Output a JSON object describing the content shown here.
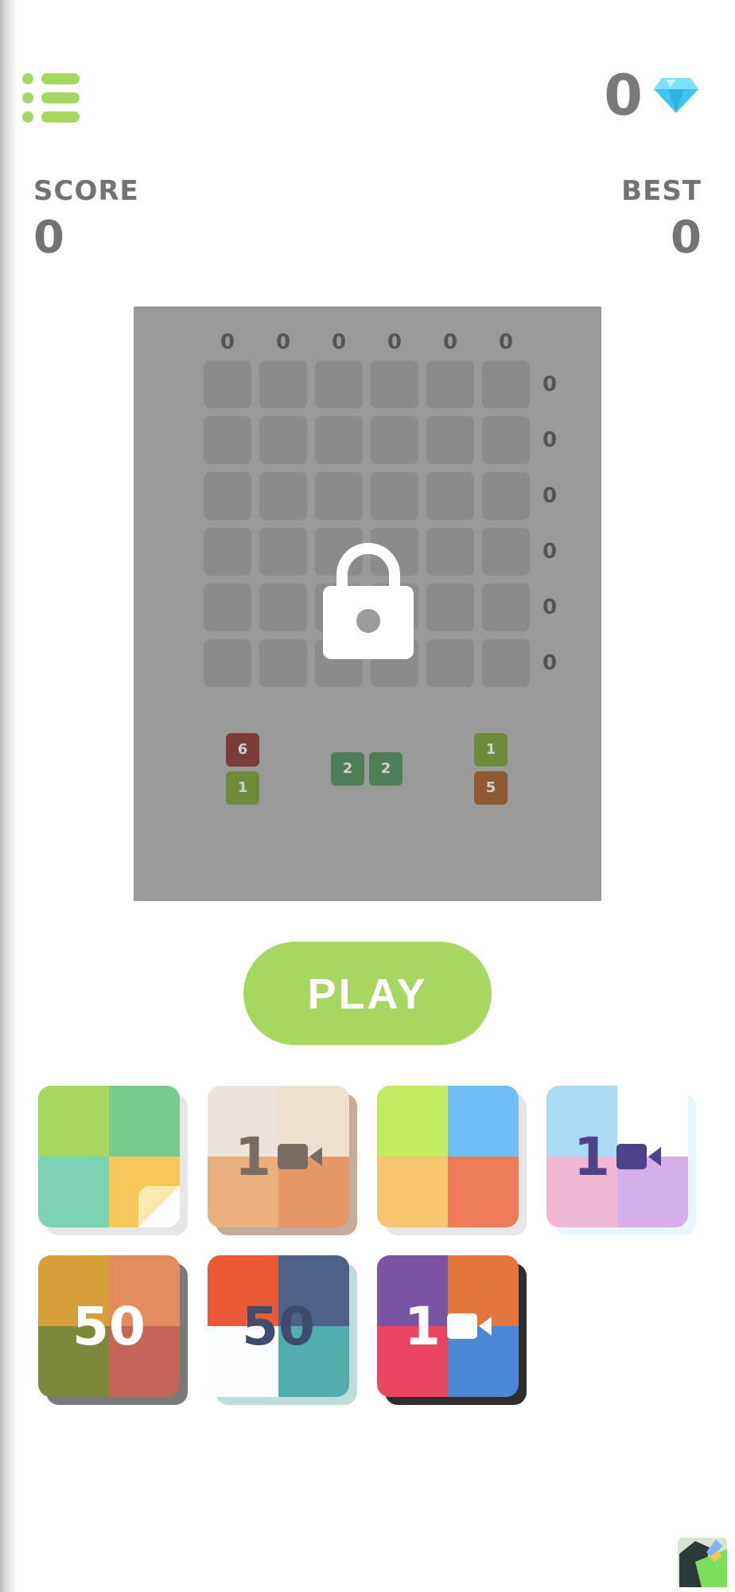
{
  "header": {
    "gems": "0"
  },
  "score": {
    "label": "SCORE",
    "value": "0"
  },
  "best": {
    "label": "BEST",
    "value": "0"
  },
  "board": {
    "col_counts": [
      "0",
      "0",
      "0",
      "0",
      "0",
      "0"
    ],
    "row_counts": [
      "0",
      "0",
      "0",
      "0",
      "0",
      "0"
    ],
    "locked": true,
    "pieces": [
      {
        "values": [
          "6",
          "1"
        ],
        "colors": [
          "#7a3e36",
          "#6e8a3a"
        ]
      },
      {
        "values": [
          "2",
          "2"
        ],
        "colors": [
          "#4e7e58",
          "#4e7e58"
        ]
      },
      {
        "values": [
          "1",
          "5"
        ],
        "colors": [
          "#6e8a3a",
          "#8e5a32"
        ]
      }
    ]
  },
  "play": {
    "label": "PLAY"
  },
  "themes": [
    {
      "colors": [
        "#a6d861",
        "#7ac98e",
        "#7bd3b3",
        "#f6c75a"
      ],
      "shadow": "#e6e6e6",
      "label": "",
      "label_color": "",
      "video": false
    },
    {
      "colors": [
        "#ece3dc",
        "#ece0cf",
        "#e8b07f",
        "#e5976a"
      ],
      "shadow": "#c2ad9b",
      "label": "1",
      "label_color": "#7a6c63",
      "video": true
    },
    {
      "colors": [
        "#c2eb62",
        "#6fbdf6",
        "#f6c56d",
        "#ee7b5a"
      ],
      "shadow": "#e6e6e6",
      "label": "",
      "label_color": "",
      "video": false
    },
    {
      "colors": [
        "#a9dcf4",
        "#ffffff",
        "#f0b7d2",
        "#d6afea"
      ],
      "shadow": "#e8f6fa",
      "label": "1",
      "label_color": "#4e428a",
      "video": true
    },
    {
      "colors": [
        "#d69f3a",
        "#e28c5e",
        "#7d883a",
        "#c46558"
      ],
      "shadow": "#7a7a7a",
      "label": "50",
      "label_color": "#ffffff",
      "video": false
    },
    {
      "colors": [
        "#e95a35",
        "#4e6189",
        "#fafcfd",
        "#52aeae"
      ],
      "shadow": "#bedcdb",
      "label": "50",
      "label_color": "#3e4a6e",
      "video": false
    },
    {
      "colors": [
        "#7b53a3",
        "#e3763a",
        "#ea4560",
        "#4a88d7"
      ],
      "shadow": "#2d2d2d",
      "label": "1",
      "label_color": "#ffffff",
      "video": true
    }
  ]
}
